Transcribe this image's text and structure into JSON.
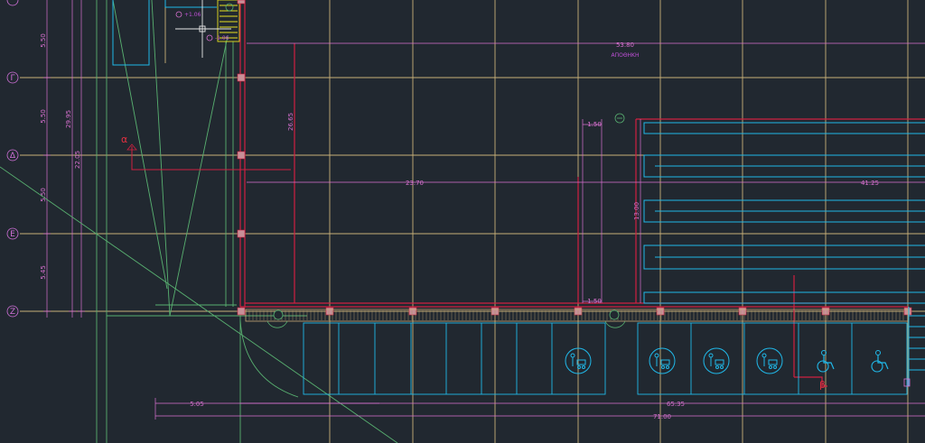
{
  "drawing": {
    "background": "#212830",
    "colors": {
      "grid": "#c8b078",
      "wall": "#d02040",
      "cyan": "#20b8e8",
      "green": "#58b070",
      "dimension": "#d870d0",
      "yellow": "#e8e020",
      "white": "#e8e8e8"
    },
    "grid_axes": [
      "Γ",
      "Δ",
      "Ε",
      "Ζ"
    ],
    "top_axis_partial": "Β",
    "vertical_dims": [
      "5.50",
      "5.50",
      "5.50",
      "5.45"
    ],
    "vertical_total_1": "29.95",
    "vertical_total_2": "22.05",
    "height_dim": "26.65",
    "top_dim": "53.80",
    "top_label": "ΑΠΟΘΗΚΗ",
    "mid_dim_left": "23.70",
    "mid_dim_right": "41.25",
    "small_dim_top": "1.50",
    "small_dim_bottom": "1.50",
    "tall_dim": "13.00",
    "bottom_dim_left": "5.05",
    "bottom_dim_mid": "65.35",
    "bottom_dim_total": "71.00",
    "section_alpha": "α",
    "section_beta": "β",
    "level_tag": "+1.06",
    "level_tag2": "-1.06",
    "parking_icons": [
      "family-parking-icon",
      "family-parking-icon",
      "family-parking-icon",
      "family-parking-icon",
      "wheelchair-icon",
      "wheelchair-icon"
    ]
  }
}
